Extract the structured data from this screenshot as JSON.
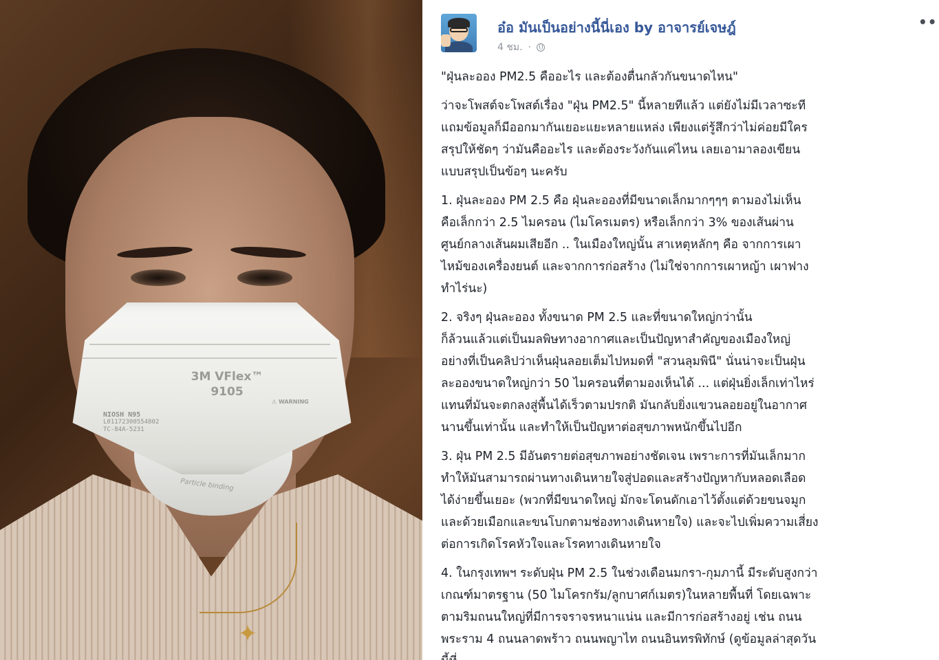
{
  "post": {
    "page_name": "อ๋อ มันเป็นอย่างนี้นี่เอง by อาจารย์เจษฎ์",
    "timestamp": "4 ชม.",
    "separator": "·",
    "privacy_icon": "globe-icon",
    "more_icon": "more-options-icon",
    "more_glyph": "•••",
    "headline": "\"ฝุ่นละออง PM2.5 คืออะไร และต้องตื่นกลัวกันขนาดไหน\"",
    "intro": "ว่าจะโพสต์จะโพสต์เรื่อง \"ฝุ่น PM2.5\" นี้หลายทีแล้ว แต่ยังไม่มีเวลาซะที\nแถมข้อมูลก็มีออกมากันเยอะแยะหลายแหล่ง เพียงแต่รู้สึกว่าไม่ค่อยมีใคร\nสรุปให้ชัดๆ ว่ามันคืออะไร และต้องระวังกันแค่ไหน เลยเอามาลองเขียน\nแบบสรุปเป็นข้อๆ นะครับ",
    "points": [
      "1. ฝุ่นละออง PM 2.5 คือ ฝุ่นละอองที่มีขนาดเล็กมากๆๆๆ ตามองไม่เห็น\nคือเล็กกว่า 2.5 ไมครอน (ไมโครเมตร) หรือเล็กกว่า 3% ของเส้นผ่าน\nศูนย์กลางเส้นผมเสียอีก .. ในเมืองใหญ่นั้น สาเหตุหลักๆ คือ จากการเผา\nไหม้ของเครื่องยนต์ และจากการก่อสร้าง (ไม่ใช่จากการเผาหญ้า เผาฟาง\nทำไร่นะ)",
      "2. จริงๆ ฝุ่นละออง ทั้งขนาด PM 2.5 และที่ขนาดใหญ่กว่านั้น\nก็ล้วนแล้วแต่เป็นมลพิษทางอากาศและเป็นปัญหาสำคัญของเมืองใหญ่\nอย่างที่เป็นคลิปว่าเห็นฝุ่นลอยเต็มไปหมดที่ \"สวนลุมพินี\" นั่นน่าจะเป็นฝุ่น\nละอองขนาดใหญ่กว่า 50 ไมครอนที่ตามองเห็นได้ ... แต่ฝุ่นยิ่งเล็กเท่าไหร่\nแทนที่มันจะตกลงสู่พื้นได้เร็วตามปรกติ มันกลับยิ่งแขวนลอยอยู่ในอากาศ\nนานขึ้นเท่านั้น และทำให้เป็นปัญหาต่อสุขภาพหนักขึ้นไปอีก",
      "3. ฝุ่น PM 2.5 มีอันตรายต่อสุขภาพอย่างชัดเจน เพราะการที่มันเล็กมาก\nทำให้มันสามารถผ่านทางเดินหายใจสู่ปอดและสร้างปัญหากับหลอดเลือด\nได้ง่ายขึ้นเยอะ (พวกที่มีขนาดใหญ่ มักจะโดนดักเอาไว้ตั้งแต่ด้วยขนจมูก\nและด้วยเมือกและขนโบกตามช่องทางเดินหายใจ) และจะไปเพิ่มความเสี่ยง\nต่อการเกิดโรคหัวใจและโรคทางเดินหายใจ",
      "4. ในกรุงเทพฯ ระดับฝุ่น PM 2.5 ในช่วงเดือนมกรา-กุมภานี้ มีระดับสูงกว่า\nเกณฑ์มาตรฐาน (50 ไมโครกรัม/ลูกบาศก์เมตร)ในหลายพื้นที่ โดยเฉพาะ\nตามริมถนนใหญ่ที่มีการจราจรหนาแน่น และมีการก่อสร้างอยู่ เช่น ถนน\nพระราม 4 ถนนลาดพร้าว ถนนพญาไท ถนนอินทรพิทักษ์ (ดูข้อมูลล่าสุดวัน\nนี้ที่"
    ]
  },
  "photo": {
    "mask_brand": "3M VFlex™",
    "mask_model": "9105",
    "mask_cert": "NIOSH N95",
    "mask_lot": "L01172300554802\nTC-84A-5231",
    "mask_warning": "⚠ WARNING",
    "mask_edge": "Particle binding"
  },
  "colors": {
    "link_blue": "#365899",
    "meta_gray": "#90949c",
    "text": "#1d2129"
  }
}
